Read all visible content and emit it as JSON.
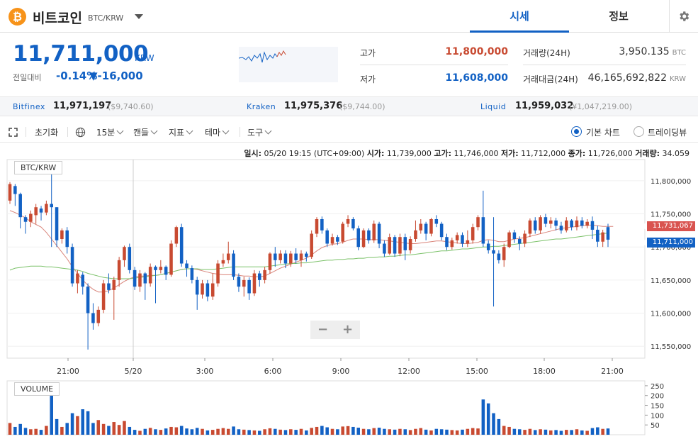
{
  "header": {
    "coin_icon_glyph": "₿",
    "coin_name": "비트코인",
    "coin_pair": "BTC/KRW",
    "tabs": [
      {
        "label": "시세",
        "active": true
      },
      {
        "label": "정보",
        "active": false
      }
    ]
  },
  "price": {
    "current": "11,711,000",
    "unit": "KRW",
    "change_label": "전일대비",
    "change_rate": "-0.14%",
    "change_amount": "▼-16,000"
  },
  "stats": {
    "high_label": "고가",
    "high_value": "11,800,000",
    "low_label": "저가",
    "low_value": "11,608,000",
    "volume_label": "거래량(24H)",
    "volume_value": "3,950.135",
    "volume_unit": "BTC",
    "amount_label": "거래대금(24H)",
    "amount_value": "46,165,692,822",
    "amount_unit": "KRW"
  },
  "exchanges": [
    {
      "name": "Bitfinex",
      "price": "11,971,197",
      "sub": "($9,740.60)"
    },
    {
      "name": "Kraken",
      "price": "11,975,376",
      "sub": "($9,744.00)"
    },
    {
      "name": "Liquid",
      "price": "11,959,032",
      "sub": "(¥1,047,219.00)"
    }
  ],
  "toolbar": {
    "reset": "초기화",
    "interval": "15분",
    "candle": "캔들",
    "indicator": "지표",
    "theme": "테마",
    "tool": "도구",
    "basic_chart": "기본 차트",
    "tradingview": "트레이딩뷰"
  },
  "ohlc": {
    "date_label": "일시:",
    "date_value": "05/20 19:15 (UTC+09:00)",
    "open_label": "시가:",
    "open_value": "11,739,000",
    "high_label": "고가:",
    "high_value": "11,746,000",
    "low_label": "저가:",
    "low_value": "11,712,000",
    "close_label": "종가:",
    "close_value": "11,726,000",
    "vol_label": "거래량:",
    "vol_value": "34.059"
  },
  "chart_labels": {
    "main": "BTC/KRW",
    "volume": "VOLUME"
  },
  "zoom": {
    "minus": "−",
    "plus": "+"
  },
  "tags": {
    "ma_price": "11,731,067",
    "last_price": "11,711,000"
  },
  "colors": {
    "up": "#c84a31",
    "down": "#1261c4",
    "ma1": "#d9847a",
    "ma2": "#7cc26a",
    "accent": "#1261c4"
  },
  "chart_data": {
    "type": "candlestick",
    "y_ticks": [
      "11,800,000",
      "11,750,000",
      "11,700,000",
      "11,650,000",
      "11,600,000",
      "11,550,000"
    ],
    "y_tick_values": [
      11800000,
      11750000,
      11700000,
      11650000,
      11600000,
      11550000
    ],
    "ylim": [
      11532000,
      11832000
    ],
    "x_ticks": [
      "21:00",
      "5/20",
      "3:00",
      "6:00",
      "9:00",
      "12:00",
      "15:00",
      "18:00",
      "21:00"
    ],
    "vol_ticks": [
      "250",
      "200",
      "150",
      "100",
      "50"
    ],
    "vol_tick_values": [
      250,
      200,
      150,
      100,
      50
    ],
    "vol_ylim": [
      0,
      275
    ],
    "candles": [
      [
        11770000,
        11795000,
        11798000,
        11765000,
        60
      ],
      [
        11792000,
        11780000,
        11795000,
        11762000,
        40
      ],
      [
        11780000,
        11745000,
        11782000,
        11728000,
        55
      ],
      [
        11745000,
        11738000,
        11748000,
        11720000,
        35
      ],
      [
        11738000,
        11750000,
        11755000,
        11730000,
        28
      ],
      [
        11748000,
        11760000,
        11765000,
        11735000,
        30
      ],
      [
        11758000,
        11752000,
        11762000,
        11740000,
        25
      ],
      [
        11752000,
        11765000,
        11770000,
        11748000,
        45
      ],
      [
        11765000,
        11760000,
        11812000,
        11700000,
        260
      ],
      [
        11760000,
        11710000,
        11760000,
        11700000,
        80
      ],
      [
        11712000,
        11725000,
        11728000,
        11705000,
        40
      ],
      [
        11725000,
        11700000,
        11730000,
        11690000,
        60
      ],
      [
        11700000,
        11645000,
        11705000,
        11640000,
        110
      ],
      [
        11645000,
        11660000,
        11665000,
        11630000,
        95
      ],
      [
        11658000,
        11640000,
        11662000,
        11628000,
        130
      ],
      [
        11640000,
        11600000,
        11645000,
        11545000,
        120
      ],
      [
        11600000,
        11585000,
        11615000,
        11575000,
        60
      ],
      [
        11585000,
        11605000,
        11610000,
        11580000,
        75
      ],
      [
        11605000,
        11645000,
        11650000,
        11600000,
        55
      ],
      [
        11645000,
        11635000,
        11660000,
        11630000,
        45
      ],
      [
        11635000,
        11650000,
        11655000,
        11590000,
        65
      ],
      [
        11650000,
        11680000,
        11685000,
        11640000,
        50
      ],
      [
        11680000,
        11700000,
        11702000,
        11670000,
        70
      ],
      [
        11700000,
        11665000,
        11705000,
        11660000,
        40
      ],
      [
        11665000,
        11640000,
        11670000,
        11635000,
        25
      ],
      [
        11640000,
        11660000,
        11665000,
        11632000,
        20
      ],
      [
        11660000,
        11645000,
        11662000,
        11620000,
        30
      ],
      [
        11645000,
        11670000,
        11675000,
        11640000,
        35
      ],
      [
        11670000,
        11665000,
        11672000,
        11615000,
        28
      ],
      [
        11665000,
        11670000,
        11680000,
        11660000,
        25
      ],
      [
        11670000,
        11658000,
        11672000,
        11650000,
        32
      ],
      [
        11658000,
        11705000,
        11710000,
        11655000,
        40
      ],
      [
        11705000,
        11730000,
        11732000,
        11700000,
        38
      ],
      [
        11730000,
        11675000,
        11735000,
        11670000,
        45
      ],
      [
        11675000,
        11668000,
        11680000,
        11655000,
        32
      ],
      [
        11668000,
        11650000,
        11672000,
        11645000,
        28
      ],
      [
        11650000,
        11628000,
        11655000,
        11605000,
        35
      ],
      [
        11628000,
        11645000,
        11650000,
        11622000,
        30
      ],
      [
        11645000,
        11625000,
        11650000,
        11618000,
        22
      ],
      [
        11625000,
        11645000,
        11660000,
        11620000,
        25
      ],
      [
        11645000,
        11675000,
        11680000,
        11640000,
        30
      ],
      [
        11675000,
        11680000,
        11690000,
        11670000,
        34
      ],
      [
        11680000,
        11690000,
        11708000,
        11675000,
        30
      ],
      [
        11690000,
        11655000,
        11695000,
        11650000,
        42
      ],
      [
        11655000,
        11640000,
        11660000,
        11632000,
        28
      ],
      [
        11640000,
        11650000,
        11655000,
        11625000,
        26
      ],
      [
        11650000,
        11630000,
        11654000,
        11620000,
        24
      ],
      [
        11630000,
        11660000,
        11665000,
        11626000,
        22
      ],
      [
        11660000,
        11650000,
        11664000,
        11640000,
        20
      ],
      [
        11650000,
        11665000,
        11670000,
        11645000,
        28
      ],
      [
        11665000,
        11690000,
        11692000,
        11660000,
        33
      ],
      [
        11690000,
        11680000,
        11700000,
        11670000,
        30
      ],
      [
        11680000,
        11690000,
        11695000,
        11675000,
        26
      ],
      [
        11690000,
        11675000,
        11695000,
        11668000,
        24
      ],
      [
        11675000,
        11690000,
        11694000,
        11670000,
        28
      ],
      [
        11690000,
        11680000,
        11698000,
        11675000,
        25
      ],
      [
        11680000,
        11690000,
        11695000,
        11670000,
        30
      ],
      [
        11690000,
        11685000,
        11693000,
        11678000,
        22
      ],
      [
        11685000,
        11720000,
        11725000,
        11682000,
        35
      ],
      [
        11720000,
        11742000,
        11745000,
        11715000,
        40
      ],
      [
        11742000,
        11725000,
        11746000,
        11720000,
        45
      ],
      [
        11725000,
        11705000,
        11728000,
        11700000,
        38
      ],
      [
        11705000,
        11715000,
        11720000,
        11702000,
        30
      ],
      [
        11715000,
        11708000,
        11718000,
        11703000,
        28
      ],
      [
        11708000,
        11735000,
        11738000,
        11705000,
        42
      ],
      [
        11735000,
        11742000,
        11748000,
        11730000,
        44
      ],
      [
        11742000,
        11728000,
        11745000,
        11725000,
        40
      ],
      [
        11728000,
        11700000,
        11732000,
        11695000,
        36
      ],
      [
        11700000,
        11725000,
        11728000,
        11698000,
        30
      ],
      [
        11725000,
        11710000,
        11728000,
        11705000,
        28
      ],
      [
        11710000,
        11735000,
        11740000,
        11706000,
        34
      ],
      [
        11735000,
        11705000,
        11738000,
        11698000,
        36
      ],
      [
        11705000,
        11690000,
        11710000,
        11685000,
        30
      ],
      [
        11690000,
        11715000,
        11720000,
        11688000,
        28
      ],
      [
        11715000,
        11690000,
        11718000,
        11685000,
        26
      ],
      [
        11690000,
        11715000,
        11720000,
        11686000,
        30
      ],
      [
        11715000,
        11695000,
        11720000,
        11680000,
        28
      ],
      [
        11695000,
        11712000,
        11716000,
        11690000,
        24
      ],
      [
        11712000,
        11725000,
        11740000,
        11708000,
        30
      ],
      [
        11725000,
        11735000,
        11742000,
        11720000,
        34
      ],
      [
        11735000,
        11720000,
        11738000,
        11710000,
        26
      ],
      [
        11720000,
        11742000,
        11744000,
        11716000,
        22
      ],
      [
        11742000,
        11735000,
        11748000,
        11730000,
        30
      ],
      [
        11735000,
        11715000,
        11738000,
        11710000,
        28
      ],
      [
        11715000,
        11700000,
        11720000,
        11695000,
        26
      ],
      [
        11700000,
        11710000,
        11714000,
        11696000,
        24
      ],
      [
        11710000,
        11718000,
        11722000,
        11705000,
        22
      ],
      [
        11718000,
        11705000,
        11722000,
        11700000,
        26
      ],
      [
        11705000,
        11710000,
        11725000,
        11700000,
        30
      ],
      [
        11710000,
        11730000,
        11735000,
        11705000,
        34
      ],
      [
        11730000,
        11745000,
        11748000,
        11725000,
        32
      ],
      [
        11745000,
        11705000,
        11785000,
        11700000,
        180
      ],
      [
        11705000,
        11695000,
        11710000,
        11690000,
        160
      ],
      [
        11695000,
        11690000,
        11745000,
        11610000,
        110
      ],
      [
        11690000,
        11680000,
        11695000,
        11675000,
        80
      ],
      [
        11680000,
        11700000,
        11705000,
        11670000,
        45
      ],
      [
        11700000,
        11722000,
        11725000,
        11698000,
        40
      ],
      [
        11722000,
        11712000,
        11726000,
        11706000,
        30
      ],
      [
        11712000,
        11705000,
        11716000,
        11695000,
        28
      ],
      [
        11705000,
        11720000,
        11725000,
        11700000,
        25
      ],
      [
        11720000,
        11740000,
        11743000,
        11715000,
        30
      ],
      [
        11740000,
        11725000,
        11745000,
        11720000,
        24
      ],
      [
        11725000,
        11745000,
        11748000,
        11720000,
        28
      ],
      [
        11745000,
        11735000,
        11750000,
        11730000,
        26
      ],
      [
        11735000,
        11740000,
        11745000,
        11728000,
        22
      ],
      [
        11740000,
        11732000,
        11744000,
        11725000,
        24
      ],
      [
        11732000,
        11725000,
        11738000,
        11720000,
        20
      ],
      [
        11725000,
        11740000,
        11745000,
        11722000,
        25
      ],
      [
        11740000,
        11730000,
        11742000,
        11725000,
        24
      ],
      [
        11730000,
        11740000,
        11746000,
        11725000,
        28
      ],
      [
        11740000,
        11732000,
        11745000,
        11728000,
        22
      ],
      [
        11732000,
        11738000,
        11742000,
        11728000,
        20
      ],
      [
        11739000,
        11726000,
        11746000,
        11712000,
        34
      ],
      [
        11726000,
        11708000,
        11732000,
        11700000,
        38
      ],
      [
        11708000,
        11722000,
        11726000,
        11700000,
        30
      ],
      [
        11730000,
        11711000,
        11735000,
        11700000,
        32
      ]
    ],
    "ma_short": [
      11755000,
      11752000,
      11748000,
      11744000,
      11738000,
      11734000,
      11730000,
      11722000,
      11712000,
      11702000,
      11692000,
      11682000,
      11670000,
      11660000,
      11650000,
      11642000,
      11636000,
      11632000,
      11632000,
      11634000,
      11638000,
      11643000,
      11648000,
      11652000,
      11655000,
      11656000,
      11656000,
      11657000,
      11657000,
      11658000,
      11660000,
      11662000,
      11664000,
      11666000,
      11667000,
      11667000,
      11666000,
      11664000,
      11662000,
      11660000,
      11659000,
      11658000,
      11658000,
      11658000,
      11657000,
      11656000,
      11656000,
      11655000,
      11655000,
      11656000,
      11660000,
      11664000,
      11668000,
      11671000,
      11674000,
      11677000,
      11680000,
      11683000,
      11688000,
      11694000,
      11699000,
      11702000,
      11704000,
      11705000,
      11707000,
      11710000,
      11712000,
      11712000,
      11712000,
      11711000,
      11711000,
      11711000,
      11710000,
      11709000,
      11708000,
      11707000,
      11706000,
      11705000,
      11705000,
      11706000,
      11707000,
      11708000,
      11709000,
      11709000,
      11708000,
      11707000,
      11706000,
      11705000,
      11705000,
      11706000,
      11707000,
      11710000,
      11711000,
      11710000,
      11708000,
      11708000,
      11710000,
      11712000,
      11713000,
      11714000,
      11716000,
      11718000,
      11720000,
      11722000,
      11724000,
      11726000,
      11728000,
      11729000,
      11730000,
      11731000,
      11732000,
      11733000,
      11733000,
      11732000,
      11731000,
      11731000,
      11731000
    ],
    "ma_long": [
      11665000,
      11668000,
      11669000,
      11670000,
      11671000,
      11671000,
      11671000,
      11670000,
      11670000,
      11669000,
      11668000,
      11667000,
      11666000,
      11665000,
      11663000,
      11660000,
      11658000,
      11656000,
      11654000,
      11653000,
      11652000,
      11652000,
      11652000,
      11652000,
      11653000,
      11654000,
      11655000,
      11656000,
      11657000,
      11658000,
      11660000,
      11662000,
      11664000,
      11666000,
      11667000,
      11667000,
      11667000,
      11666000,
      11666000,
      11666000,
      11667000,
      11668000,
      11669000,
      11670000,
      11670000,
      11670000,
      11670000,
      11670000,
      11670000,
      11670000,
      11671000,
      11672000,
      11673000,
      11674000,
      11675000,
      11675000,
      11676000,
      11676000,
      11677000,
      11678000,
      11679000,
      11680000,
      11680000,
      11681000,
      11681000,
      11682000,
      11682000,
      11683000,
      11683000,
      11684000,
      11684000,
      11685000,
      11685000,
      11686000,
      11686000,
      11687000,
      11688000,
      11688000,
      11689000,
      11690000,
      11691000,
      11692000,
      11693000,
      11694000,
      11694000,
      11695000,
      11696000,
      11697000,
      11697000,
      11698000,
      11699000,
      11700000,
      11700000,
      11701000,
      11701000,
      11702000,
      11703000,
      11704000,
      11705000,
      11706000,
      11707000,
      11708000,
      11709000,
      11710000,
      11711000,
      11712000,
      11712000,
      11713000,
      11714000,
      11715000,
      11716000,
      11717000,
      11718000,
      11719000,
      11720000,
      11721000
    ]
  }
}
